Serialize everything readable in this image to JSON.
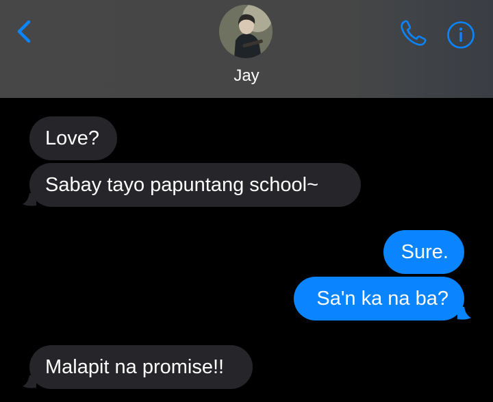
{
  "colors": {
    "header_bg": "#474747",
    "accent": "#0a84ff",
    "incoming_bubble": "#26252a",
    "outgoing_bubble": "#0a84ff",
    "background": "#000000"
  },
  "header": {
    "back_icon": "chevron-left-icon",
    "contact_name": "Jay",
    "call_icon": "phone-icon",
    "info_icon": "info-icon"
  },
  "messages": [
    {
      "direction": "incoming",
      "text": "Love?"
    },
    {
      "direction": "incoming",
      "text": "Sabay tayo papuntang school~"
    },
    {
      "direction": "outgoing",
      "text": "Sure."
    },
    {
      "direction": "outgoing",
      "text": "Sa'n ka na ba?"
    },
    {
      "direction": "incoming",
      "text": "Malapit na promise!!"
    }
  ]
}
